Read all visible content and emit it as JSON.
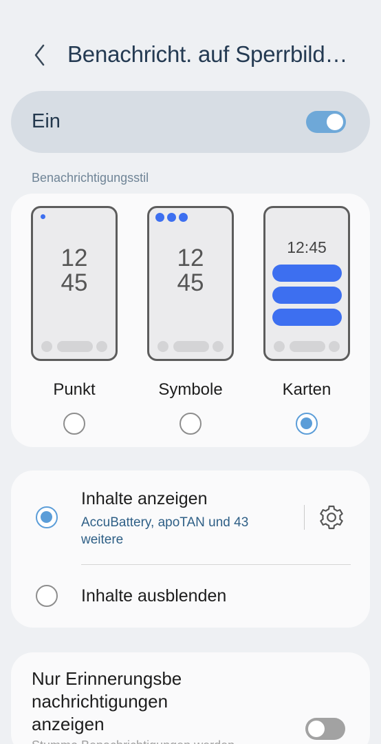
{
  "header": {
    "title": "Benachricht. auf Sperrbild…",
    "back_icon": "chevron-left-icon"
  },
  "master_toggle": {
    "label": "Ein",
    "on": true
  },
  "style_section": {
    "label": "Benachrichtigungsstil",
    "options": [
      {
        "name": "Punkt",
        "clock_hour": "12",
        "clock_minute": "45",
        "selected": false
      },
      {
        "name": "Symbole",
        "clock_hour": "12",
        "clock_minute": "45",
        "selected": false
      },
      {
        "name": "Karten",
        "clock": "12:45",
        "selected": true
      }
    ]
  },
  "content": {
    "show": {
      "title": "Inhalte anzeigen",
      "subtitle": "AccuBattery, apoTAN und 43 weitere",
      "selected": true,
      "settings_icon": "gear-icon"
    },
    "hide": {
      "title": "Inhalte ausblenden",
      "selected": false
    }
  },
  "reminder": {
    "title": "Nur Erinnerungsbe nachrichtigungen anzeigen",
    "subtitle": "Stummo Benachrichtigungen werden…",
    "on": false
  },
  "colors": {
    "accent": "#5b9dd8",
    "preview_blue": "#3d6ff0",
    "title_text": "#243a52",
    "background": "#eef0f3"
  }
}
